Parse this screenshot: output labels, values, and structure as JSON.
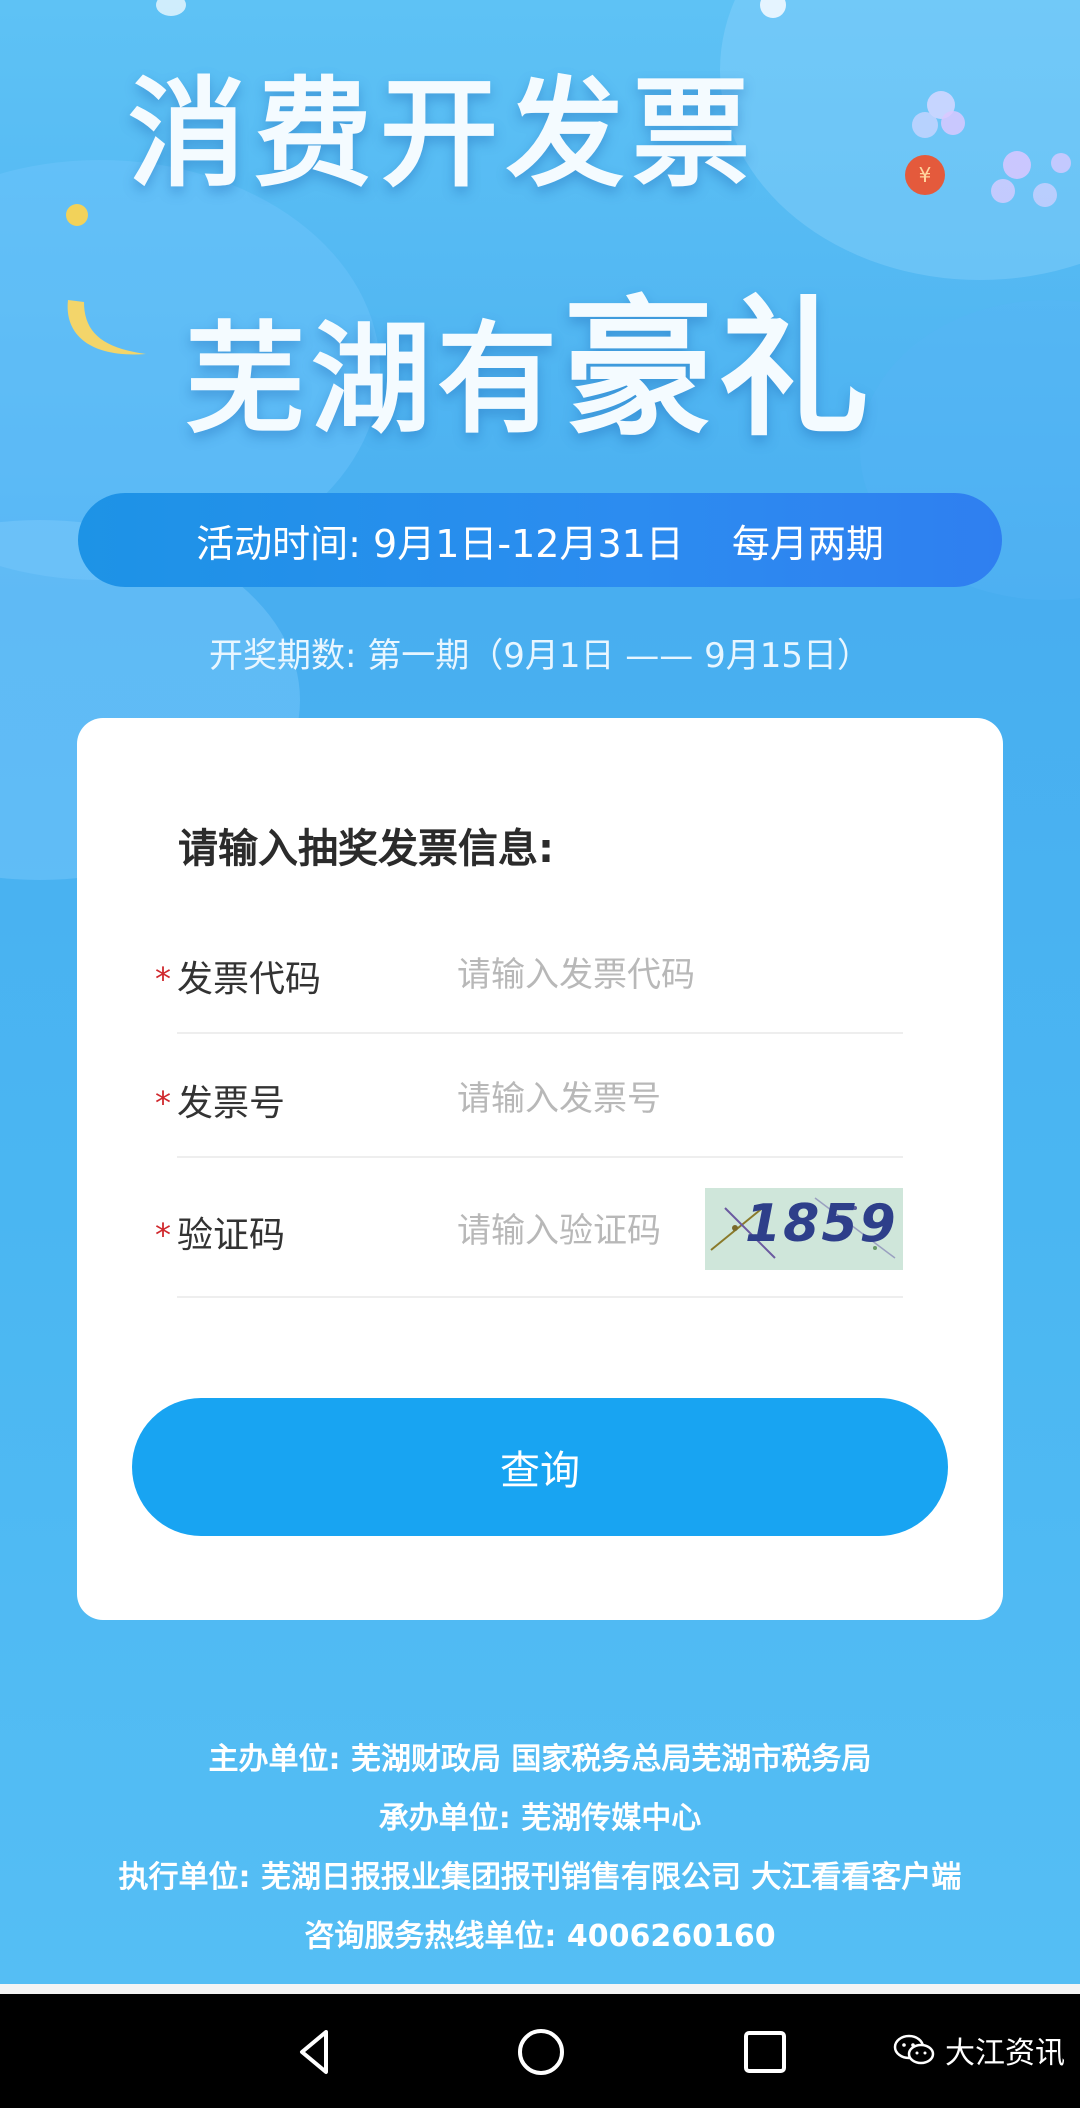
{
  "hero": {
    "line1": "消费开发票",
    "line2_small": "芜湖有",
    "line2_big": "豪礼"
  },
  "activity": {
    "time": "活动时间: 9月1日-12月31日",
    "frequency": "每月两期"
  },
  "period_text": "开奖期数: 第一期（9月1日 —— 9月15日）",
  "form": {
    "title": "请输入抽奖发票信息:",
    "fields": [
      {
        "label": "发票代码",
        "placeholder": "请输入发票代码",
        "value": ""
      },
      {
        "label": "发票号",
        "placeholder": "请输入发票号",
        "value": ""
      },
      {
        "label": "验证码",
        "placeholder": "请输入验证码",
        "value": ""
      }
    ],
    "required_mark": "*",
    "captcha_text": "1859",
    "submit_label": "查询"
  },
  "footer": {
    "organizer": "主办单位: 芜湖财政局 国家税务总局芜湖市税务局",
    "undertaker": "承办单位: 芜湖传媒中心",
    "executor": "执行单位: 芜湖日报报业集团报刊销售有限公司 大江看看客户端",
    "hotline": "咨询服务热线单位: 4006260160"
  },
  "watermark": {
    "icon": "wechat-icon",
    "text": "大江资讯"
  },
  "nav_icons": [
    "back-icon",
    "home-icon",
    "recent-apps-icon"
  ],
  "colors": {
    "accent": "#18a4f2",
    "required": "#d0282d",
    "pill": "#2c8cf0"
  }
}
